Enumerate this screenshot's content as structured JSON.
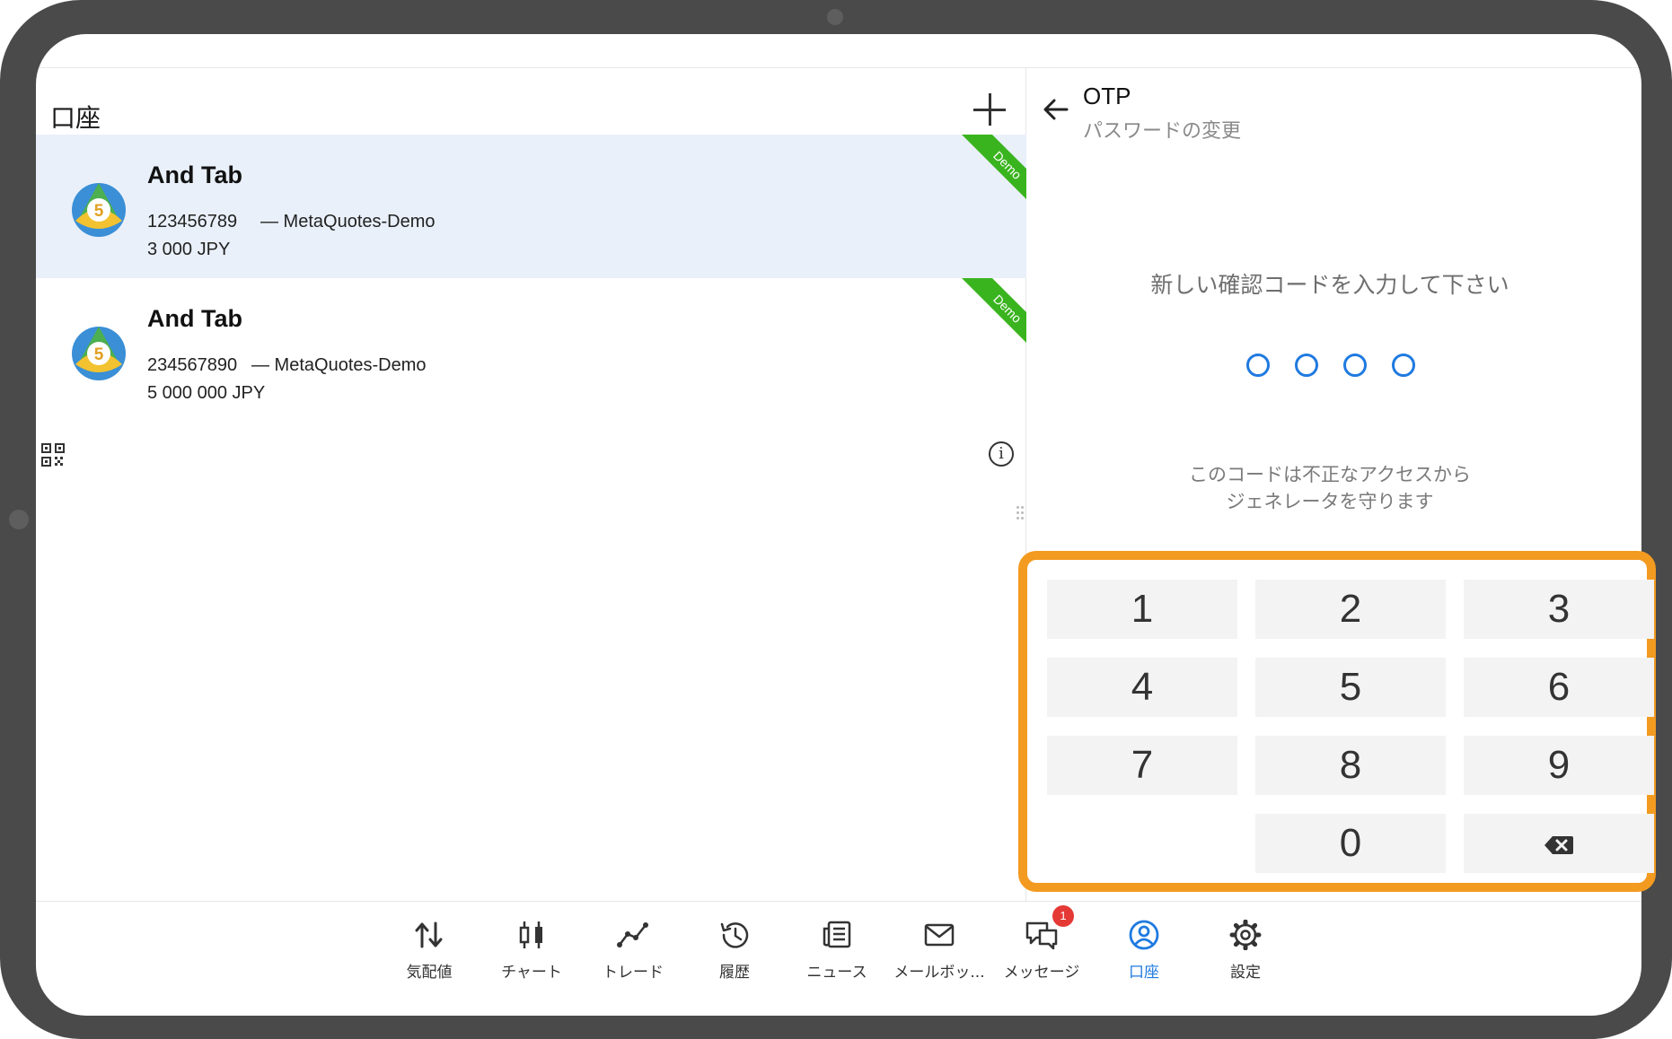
{
  "accounts_panel": {
    "title": "口座",
    "add_button_label": "+",
    "accounts": [
      {
        "name": "And Tab",
        "login": "123456789",
        "server": "— MetaQuotes-Demo",
        "balance": "3 000 JPY",
        "badge": "Demo",
        "selected": true
      },
      {
        "name": "And Tab",
        "login": "234567890",
        "server": "— MetaQuotes-Demo",
        "balance": "5 000 000 JPY",
        "badge": "Demo",
        "selected": false
      }
    ]
  },
  "otp_panel": {
    "title": "OTP",
    "subtitle": "パスワードの変更",
    "prompt": "新しい確認コードを入力して下さい",
    "code_length": 4,
    "note_lines": [
      "このコードは不正なアクセスから",
      "ジェネレータを守ります"
    ]
  },
  "keypad": {
    "keys": [
      "1",
      "2",
      "3",
      "4",
      "5",
      "6",
      "7",
      "8",
      "9",
      "0"
    ],
    "backspace_icon": "backspace-icon"
  },
  "bottom_nav": {
    "items": [
      {
        "label": "気配値",
        "icon": "quotes-icon"
      },
      {
        "label": "チャート",
        "icon": "chart-icon"
      },
      {
        "label": "トレード",
        "icon": "trade-icon"
      },
      {
        "label": "履歴",
        "icon": "history-icon"
      },
      {
        "label": "ニュース",
        "icon": "news-icon"
      },
      {
        "label": "メールボッ...",
        "icon": "mailbox-icon"
      },
      {
        "label": "メッセージ",
        "icon": "messages-icon",
        "badge": "1"
      },
      {
        "label": "口座",
        "icon": "accounts-icon",
        "active": true
      },
      {
        "label": "設定",
        "icon": "settings-icon"
      }
    ]
  },
  "colors": {
    "accent": "#1f7ae0",
    "highlight": "#f39a20",
    "demo_ribbon": "#3ab41e",
    "selected_row": "#e9f0fa",
    "badge": "#e53935"
  }
}
